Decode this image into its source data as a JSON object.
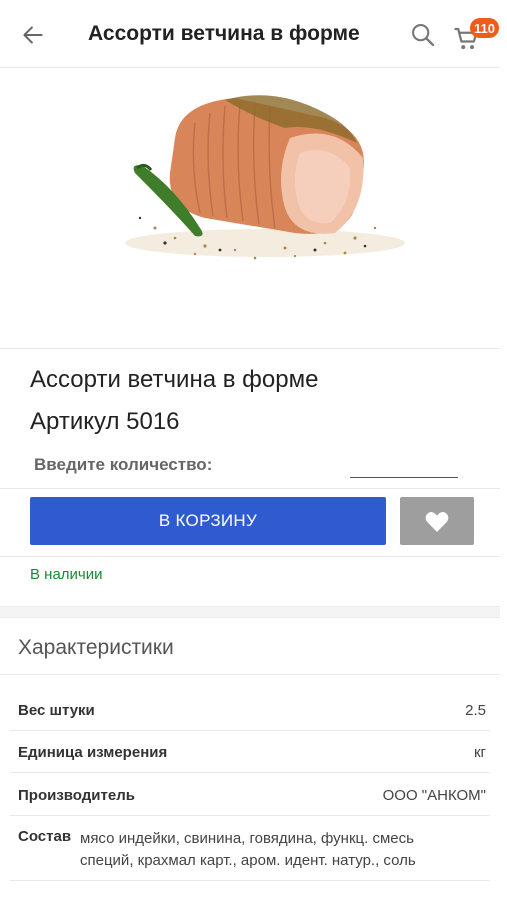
{
  "header": {
    "title": "Ассорти ветчина в форме",
    "cart_count": "110"
  },
  "icons": {
    "back": "arrow-left-icon",
    "search": "search-icon",
    "cart": "cart-icon",
    "favorite": "heart-icon"
  },
  "product": {
    "name": "Ассорти ветчина в форме",
    "sku": "Артикул 5016",
    "quantity_label": "Введите количество:",
    "quantity_value": "",
    "add_to_cart_label": "В КОРЗИНУ",
    "stock_status": "В наличии"
  },
  "specs": {
    "title": "Характеристики",
    "rows": [
      {
        "label": "Вес штуки",
        "value": "2.5"
      },
      {
        "label": "Единица измерения",
        "value": "кг"
      },
      {
        "label": "Производитель",
        "value": "ООО \"АНКОМ\""
      }
    ],
    "composition_label": "Состав",
    "composition_line1": "мясо индейки, свинина, говядина, функц. смесь",
    "composition_line2": "специй, крахмал карт., аром. идент. натур., соль"
  },
  "colors": {
    "primary_button": "#2f5bd0",
    "favorite_button": "#9e9e9e",
    "in_stock": "#1b8a2c",
    "badge": "#f05a1a"
  }
}
